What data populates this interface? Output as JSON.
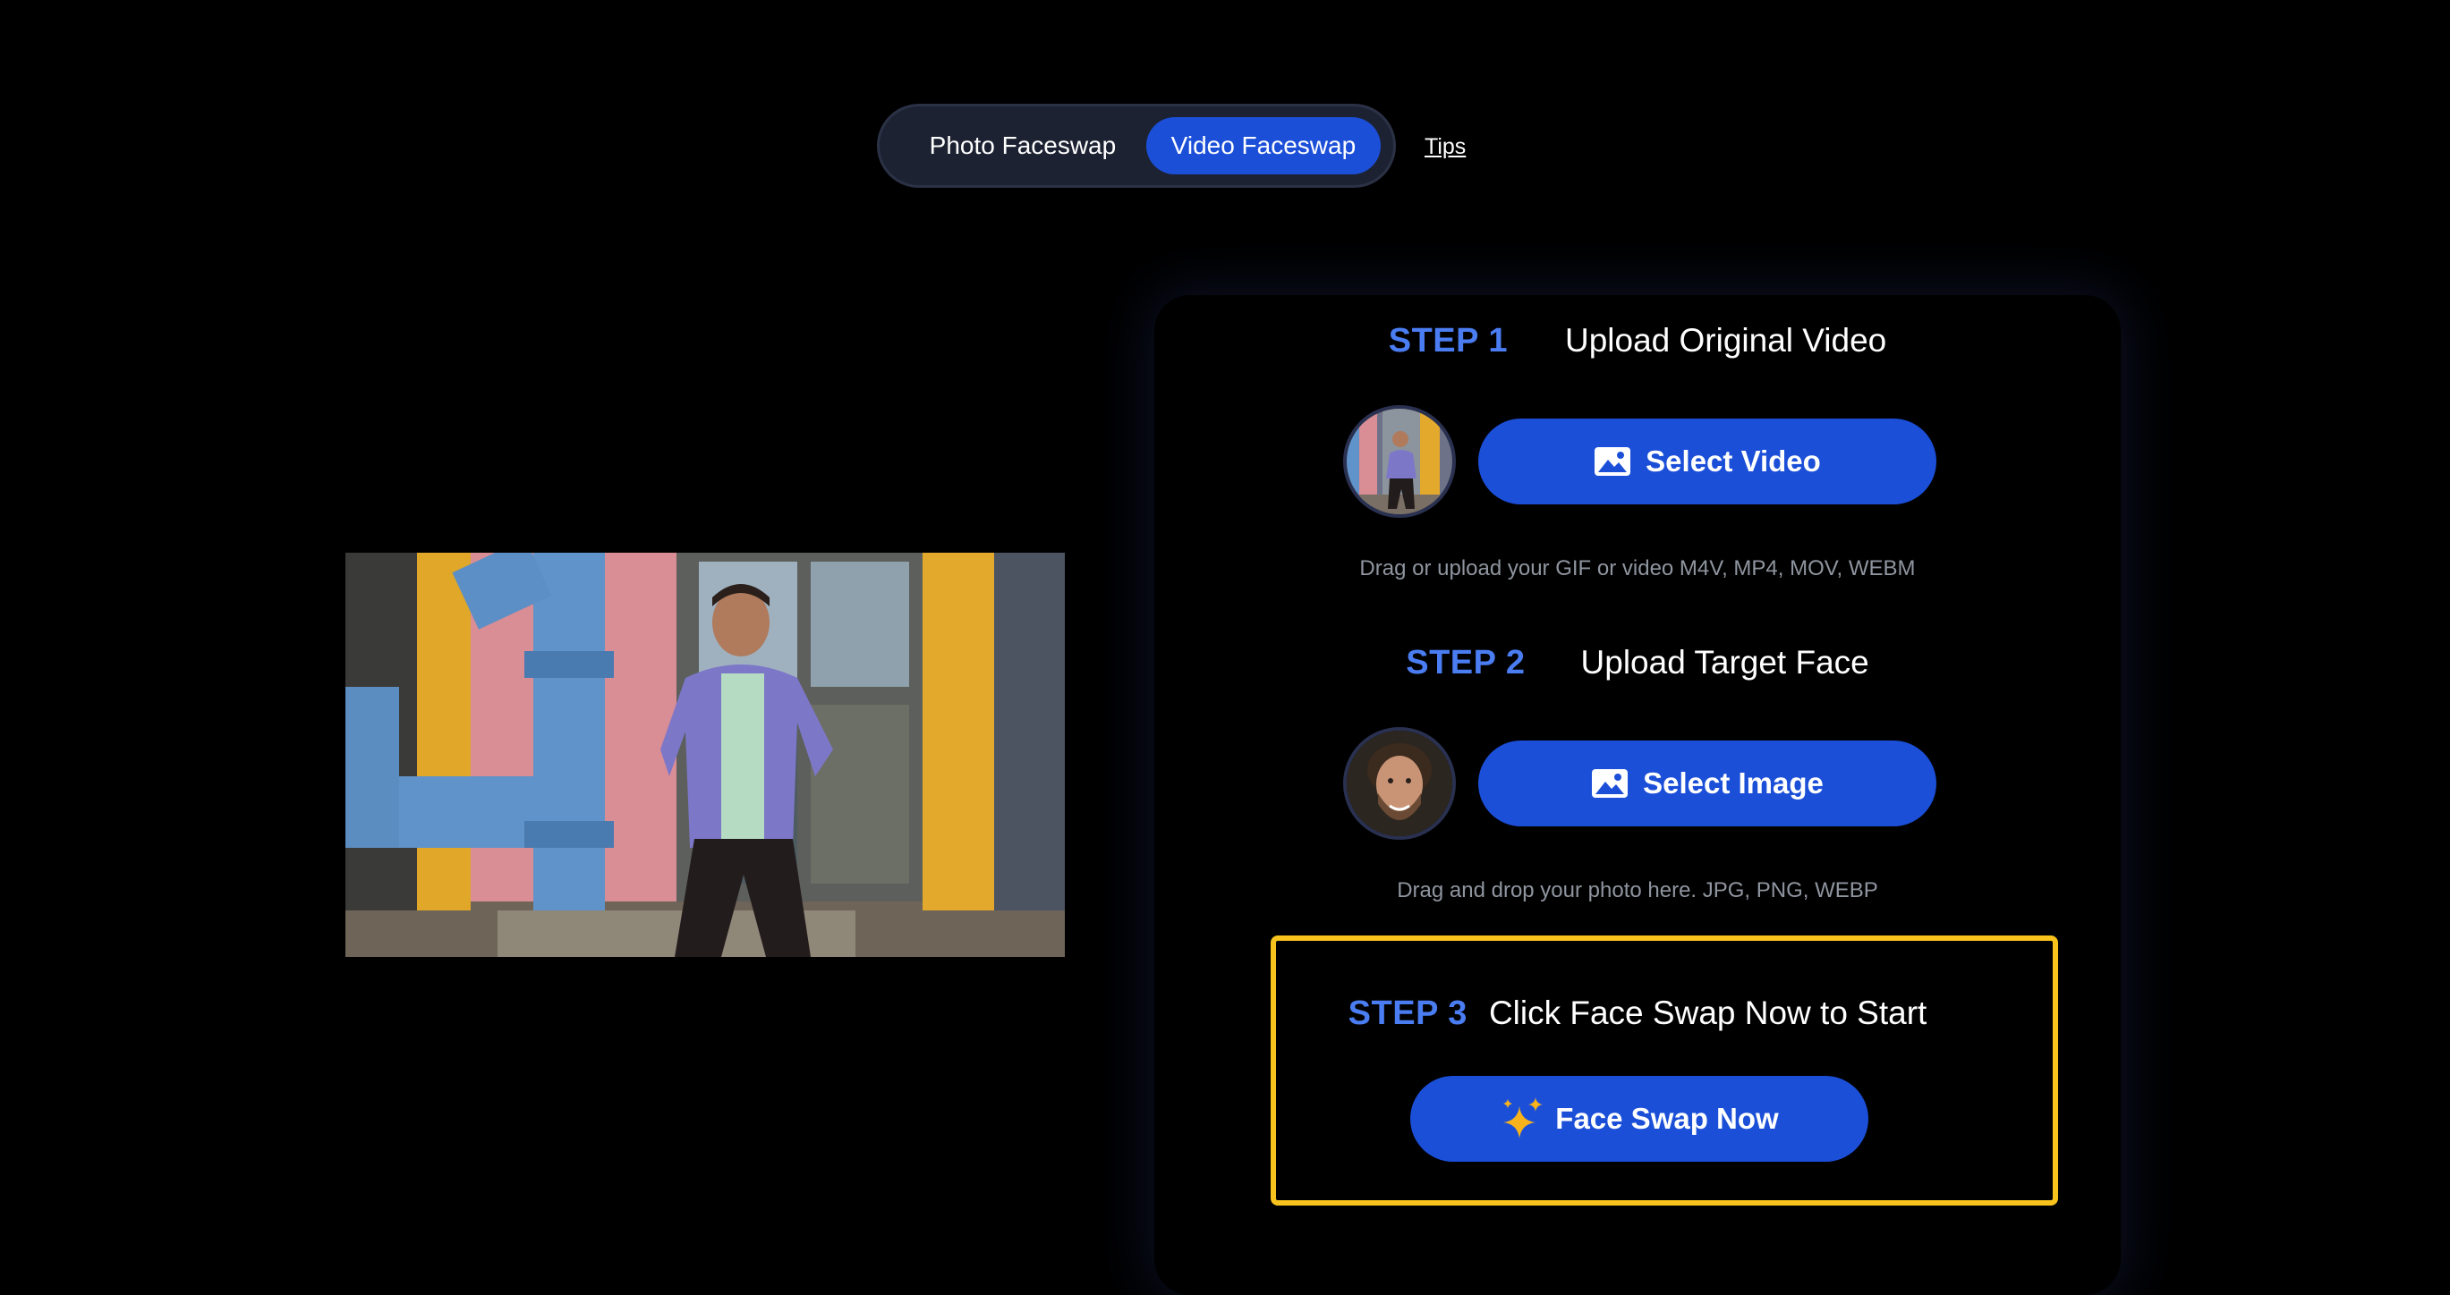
{
  "mode_switch": {
    "tabs": [
      {
        "label": "Photo Faceswap",
        "active": false
      },
      {
        "label": "Video Faceswap",
        "active": true
      }
    ],
    "tips_label": "Tips"
  },
  "steps": [
    {
      "number": "STEP 1",
      "title": "Upload Original Video",
      "button_label": "Select Video",
      "button_icon": "image-icon",
      "hint": "Drag or upload your GIF or video M4V, MP4, MOV, WEBM"
    },
    {
      "number": "STEP 2",
      "title": "Upload Target Face",
      "button_label": "Select Image",
      "button_icon": "image-icon",
      "hint": "Drag and drop your photo here. JPG, PNG, WEBP"
    },
    {
      "number": "STEP 3",
      "title": "Click Face Swap Now to Start",
      "button_label": "Face Swap Now",
      "button_icon": "sparkles-icon"
    }
  ],
  "colors": {
    "background": "#000000",
    "accent_blue": "#1b4fd8",
    "step_label_blue": "#4a7df2",
    "highlight_yellow": "#f7c31c",
    "hint_gray": "#8f959f"
  }
}
